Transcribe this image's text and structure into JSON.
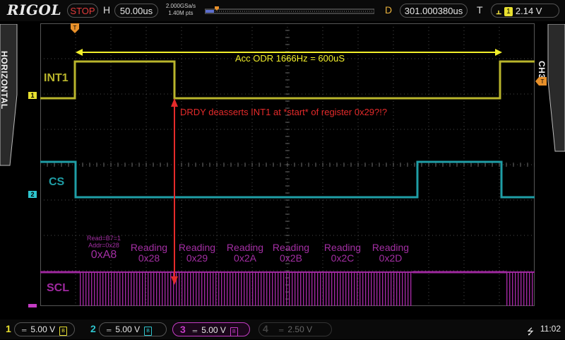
{
  "brand": "RIGOL",
  "topbar": {
    "run_state": "STOP",
    "h_label": "H",
    "timebase": "50.00us",
    "sample_rate": "2.000GSa/s",
    "memory_depth": "1.40M pts",
    "d_label": "D",
    "h_delay": "301.000380us",
    "t_label": "T",
    "trigger_source": "1",
    "trigger_level": "2.14 V"
  },
  "side": {
    "left_label": "HORIZONTAL",
    "right_label": "CH3"
  },
  "channels_on_screen": {
    "int1": "INT1",
    "cs": "CS",
    "scl": "SCL"
  },
  "annotations": {
    "odr": "Acc ODR 1666Hz = 600uS",
    "drdy": "DRDY deasserts INT1 at *start* of register 0x29?!?"
  },
  "decode_first": {
    "line1": "Read=B7=1",
    "line2": "Addr=0x28",
    "value": "0xA8"
  },
  "decode_labels": [
    {
      "top": "Reading",
      "bottom": "0x28"
    },
    {
      "top": "Reading",
      "bottom": "0x29"
    },
    {
      "top": "Reading",
      "bottom": "0x2A"
    },
    {
      "top": "Reading",
      "bottom": "0x2B"
    },
    {
      "top": "Reading",
      "bottom": "0x2C"
    },
    {
      "top": "Reading",
      "bottom": "0x2D"
    }
  ],
  "bottom": {
    "ch1": {
      "num": "1",
      "scale": "5.00 V",
      "color": "#e8e030"
    },
    "ch2": {
      "num": "2",
      "scale": "5.00 V",
      "color": "#2ec6cf"
    },
    "ch3": {
      "num": "3",
      "scale": "5.00 V",
      "color": "#c43cc4"
    },
    "ch4": {
      "num": "4",
      "scale": "2.50 V",
      "color": "#555555"
    },
    "clock": "11:02"
  },
  "colors": {
    "ch1": "#b9b52c",
    "ch2": "#1f9ea6",
    "ch3": "#a028a0",
    "annot_red": "#e52a2a",
    "annot_yellow": "#f2ef2a",
    "trigger_marker": "#e8902a"
  }
}
